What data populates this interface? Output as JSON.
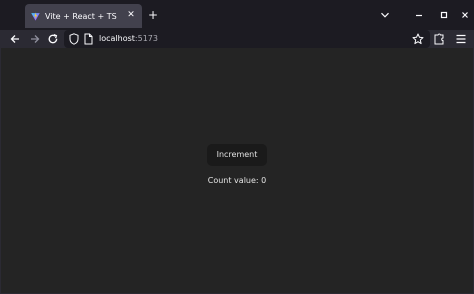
{
  "tab": {
    "title": "Vite + React + TS",
    "close_glyph": "✕"
  },
  "new_tab_glyph": "+",
  "address": {
    "host": "localhost",
    "port": ":5173"
  },
  "app": {
    "button_label": "Increment",
    "count_label": "Count value: ",
    "count_value": "0"
  },
  "colors": {
    "chrome_bg": "#1c1b22",
    "toolbar_bg": "#2b2a33",
    "tab_bg": "#42414d",
    "page_bg": "#242424",
    "button_bg": "#1a1a1a"
  },
  "icons": [
    "vite-favicon-icon",
    "close-icon",
    "plus-icon",
    "chevron-down-icon",
    "minimize-icon",
    "maximize-icon",
    "close-window-icon",
    "back-icon",
    "forward-icon",
    "reload-icon",
    "shield-icon",
    "page-icon",
    "star-icon",
    "extensions-icon",
    "hamburger-menu-icon"
  ]
}
